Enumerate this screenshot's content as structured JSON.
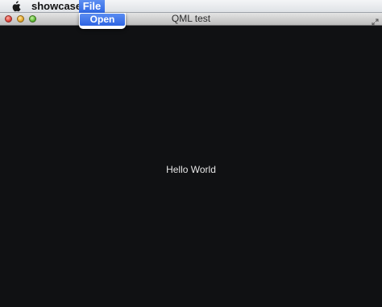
{
  "menubar": {
    "apple_icon": "apple-logo-icon",
    "app_name": "showcase",
    "file_menu_label": "File"
  },
  "file_menu": {
    "items": [
      {
        "label": "Open"
      }
    ]
  },
  "window": {
    "title": "QML test",
    "controls": [
      "close-icon",
      "minimize-icon",
      "zoom-icon"
    ],
    "resize_icon": "fullscreen-icon"
  },
  "content": {
    "text": "Hello World",
    "background": "#101113"
  },
  "colors": {
    "menu_highlight": "#3a72ea",
    "close": "#e0443a",
    "minimize": "#e4a82a",
    "zoom": "#5dbb34"
  }
}
